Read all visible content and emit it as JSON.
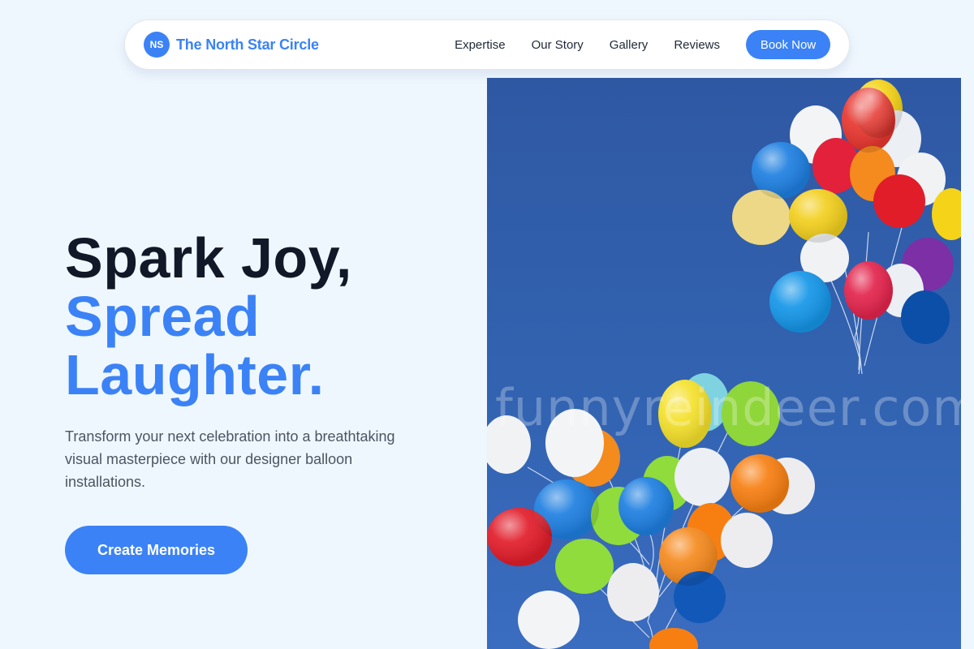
{
  "nav": {
    "logo_initials": "NS",
    "brand_name": "The North Star Circle",
    "links": [
      {
        "label": "Expertise"
      },
      {
        "label": "Our Story"
      },
      {
        "label": "Gallery"
      },
      {
        "label": "Reviews"
      }
    ],
    "cta_label": "Book Now"
  },
  "hero": {
    "title_line1": "Spark Joy,",
    "title_line2a": "Spread",
    "title_line2b": "Laughter.",
    "description": "Transform your next celebration into a breathtaking visual masterpiece with our designer balloon installations.",
    "cta_label": "Create Memories"
  },
  "image": {
    "subject": "balloon-bunches-photo",
    "watermark": "funnyreindeer.com"
  },
  "colors": {
    "accent": "#3b82f6",
    "heading": "#111827",
    "body_text": "#4b5563",
    "page_bg": "#eff7fe",
    "sky": "#2f58a3"
  }
}
